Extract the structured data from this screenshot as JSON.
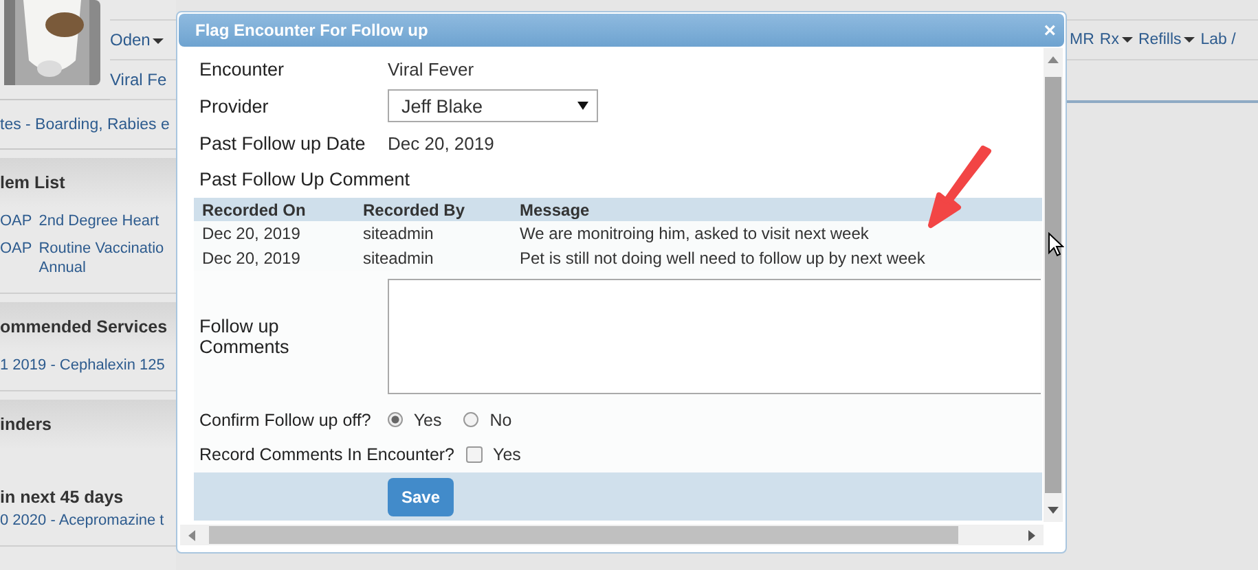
{
  "header": {
    "pet_menu": "Oden",
    "encounter": "Viral Fe",
    "nav": [
      {
        "label": "MR",
        "dropdown": false
      },
      {
        "label": "Rx",
        "dropdown": true
      },
      {
        "label": "Refills",
        "dropdown": true
      },
      {
        "label": "Lab /",
        "dropdown": false
      }
    ]
  },
  "alerts": "tes - Boarding, Rabies e",
  "sections": [
    {
      "title": "lem List",
      "items": [
        {
          "prefix": "OAP",
          "lines": [
            "2nd Degree Heart"
          ]
        },
        {
          "prefix": "OAP",
          "lines": [
            "Routine Vaccinatio",
            "Annual"
          ]
        }
      ]
    },
    {
      "title": "ommended Services",
      "items": [
        {
          "lines": [
            "1 2019 - Cephalexin 125"
          ]
        }
      ]
    },
    {
      "title": "inders",
      "subtitle": "in next 45 days",
      "items": [
        {
          "lines": [
            "0 2020 - Acepromazine t"
          ]
        }
      ]
    }
  ],
  "dialog": {
    "title": "Flag Encounter For Follow up",
    "close": "×",
    "encounter": {
      "label": "Encounter",
      "value": "Viral Fever"
    },
    "provider": {
      "label": "Provider",
      "value": "Jeff Blake"
    },
    "past_date": {
      "label": "Past Follow up Date",
      "value": "Dec 20, 2019"
    },
    "past_comment_title": "Past Follow Up Comment",
    "table": {
      "columns": [
        "Recorded On",
        "Recorded By",
        "Message"
      ],
      "rows": [
        [
          "Dec 20, 2019",
          "siteadmin",
          "We are monitroing him, asked to visit next week"
        ],
        [
          "Dec 20, 2019",
          "siteadmin",
          "Pet is still not doing well need to follow up by next week"
        ]
      ]
    },
    "comments": {
      "label": "Follow up Comments"
    },
    "confirm": {
      "label": "Confirm Follow up off?",
      "options": [
        {
          "label": "Yes",
          "selected": true
        },
        {
          "label": "No",
          "selected": false
        }
      ]
    },
    "record": {
      "label": "Record Comments In Encounter?",
      "option": "Yes",
      "checked": false
    },
    "save": "Save"
  }
}
